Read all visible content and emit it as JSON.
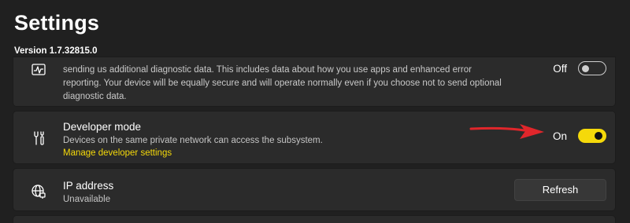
{
  "header": {
    "title": "Settings",
    "version": "Version 1.7.32815.0"
  },
  "diagnostic": {
    "description": "sending us additional diagnostic data. This includes data about how you use apps and enhanced error reporting. Your device will be equally secure and will operate normally even if you choose not to send optional diagnostic data.",
    "toggle_label": "Off",
    "toggle_state": "off",
    "icon": "diagnostics-chart-icon"
  },
  "developer_mode": {
    "title": "Developer mode",
    "subtitle": "Devices on the same private network can access the subsystem.",
    "link": "Manage developer settings",
    "toggle_label": "On",
    "toggle_state": "on",
    "icon": "tools-icon"
  },
  "ip_address": {
    "title": "IP address",
    "subtitle": "Unavailable",
    "button_label": "Refresh",
    "icon": "globe-network-icon"
  },
  "colors": {
    "background": "#202020",
    "card": "#2b2b2b",
    "accent": "#f5d90a",
    "annotation_arrow": "#e0262b"
  }
}
